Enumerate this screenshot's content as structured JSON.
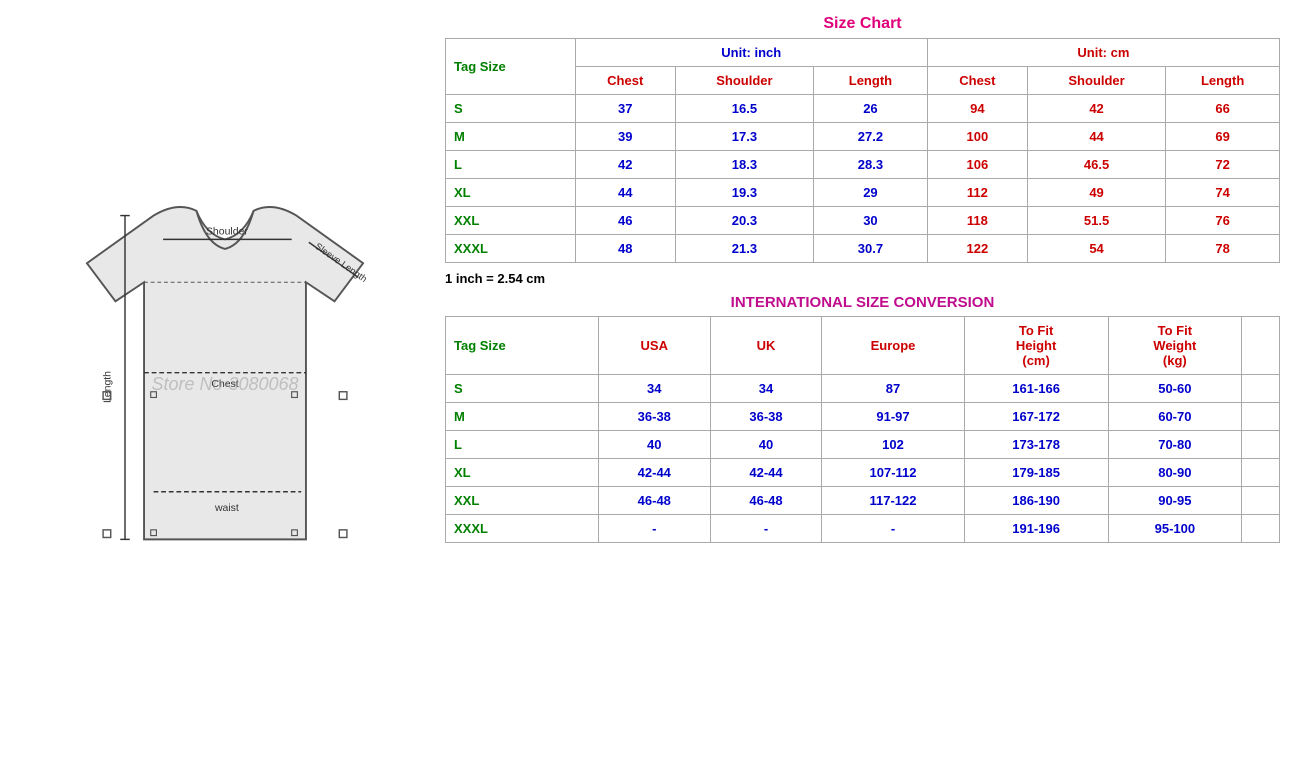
{
  "title": "Size Chart",
  "sizeChart": {
    "title": "Size Chart",
    "unitInch": "Unit: inch",
    "unitCm": "Unit: cm",
    "tagSizeLabel": "Tag Size",
    "columns": {
      "inch": [
        "Chest",
        "Shoulder",
        "Length"
      ],
      "cm": [
        "Chest",
        "Shoulder",
        "Length"
      ]
    },
    "rows": [
      {
        "tag": "S",
        "inch": [
          "37",
          "16.5",
          "26"
        ],
        "cm": [
          "94",
          "42",
          "66"
        ]
      },
      {
        "tag": "M",
        "inch": [
          "39",
          "17.3",
          "27.2"
        ],
        "cm": [
          "100",
          "44",
          "69"
        ]
      },
      {
        "tag": "L",
        "inch": [
          "42",
          "18.3",
          "28.3"
        ],
        "cm": [
          "106",
          "46.5",
          "72"
        ]
      },
      {
        "tag": "XL",
        "inch": [
          "44",
          "19.3",
          "29"
        ],
        "cm": [
          "112",
          "49",
          "74"
        ]
      },
      {
        "tag": "XXL",
        "inch": [
          "46",
          "20.3",
          "30"
        ],
        "cm": [
          "118",
          "51.5",
          "76"
        ]
      },
      {
        "tag": "XXXL",
        "inch": [
          "48",
          "21.3",
          "30.7"
        ],
        "cm": [
          "122",
          "54",
          "78"
        ]
      }
    ],
    "conversionNote": "1 inch = 2.54 cm"
  },
  "intlConversion": {
    "title": "INTERNATIONAL SIZE CONVERSION",
    "tagSizeLabel": "Tag Size",
    "columns": [
      "USA",
      "UK",
      "Europe",
      "To Fit Height (cm)",
      "To Fit Weight (kg)"
    ],
    "rows": [
      {
        "tag": "S",
        "usa": "34",
        "uk": "34",
        "europe": "87",
        "height": "161-166",
        "weight": "50-60"
      },
      {
        "tag": "M",
        "usa": "36-38",
        "uk": "36-38",
        "europe": "91-97",
        "height": "167-172",
        "weight": "60-70"
      },
      {
        "tag": "L",
        "usa": "40",
        "uk": "40",
        "europe": "102",
        "height": "173-178",
        "weight": "70-80"
      },
      {
        "tag": "XL",
        "usa": "42-44",
        "uk": "42-44",
        "europe": "107-112",
        "height": "179-185",
        "weight": "80-90"
      },
      {
        "tag": "XXL",
        "usa": "46-48",
        "uk": "46-48",
        "europe": "117-122",
        "height": "186-190",
        "weight": "90-95"
      },
      {
        "tag": "XXXL",
        "usa": "-",
        "uk": "-",
        "europe": "-",
        "height": "191-196",
        "weight": "95-100"
      }
    ]
  },
  "tshirt": {
    "labels": {
      "shoulder": "Shoulder",
      "sleeveLength": "Sleeve Length",
      "chest": "Chest",
      "length": "Length",
      "waist": "waist"
    }
  },
  "watermark": "Store No-3080068"
}
